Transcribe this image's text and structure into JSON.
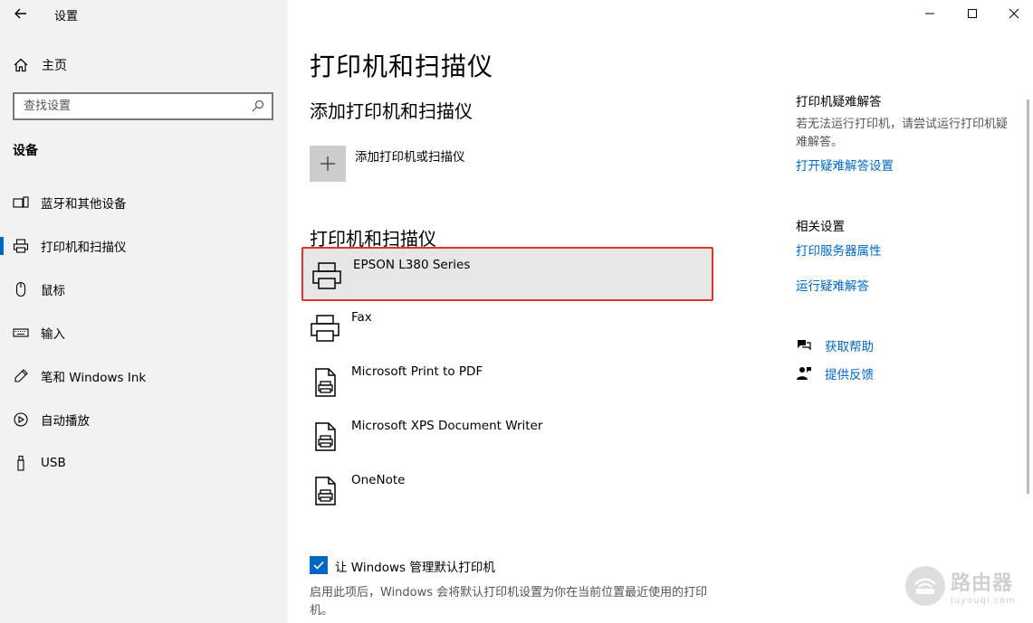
{
  "window": {
    "title": "设置",
    "minimize_icon": "minimize-icon",
    "maximize_icon": "maximize-icon",
    "close_icon": "close-icon"
  },
  "sidebar": {
    "home_label": "主页",
    "search_placeholder": "查找设置",
    "section_label": "设备",
    "items": [
      {
        "label": "蓝牙和其他设备",
        "icon": "bluetooth-devices-icon",
        "active": false
      },
      {
        "label": "打印机和扫描仪",
        "icon": "printer-icon",
        "active": true
      },
      {
        "label": "鼠标",
        "icon": "mouse-icon",
        "active": false
      },
      {
        "label": "输入",
        "icon": "keyboard-icon",
        "active": false
      },
      {
        "label": "笔和 Windows Ink",
        "icon": "pen-icon",
        "active": false
      },
      {
        "label": "自动播放",
        "icon": "autoplay-icon",
        "active": false
      },
      {
        "label": "USB",
        "icon": "usb-icon",
        "active": false
      }
    ]
  },
  "main": {
    "page_title": "打印机和扫描仪",
    "add_section_title": "添加打印机和扫描仪",
    "add_button_label": "添加打印机或扫描仪",
    "list_section_title": "打印机和扫描仪",
    "printers": [
      {
        "name": "EPSON L380 Series",
        "icon": "printer-icon",
        "selected": true
      },
      {
        "name": "Fax",
        "icon": "printer-icon",
        "selected": false
      },
      {
        "name": "Microsoft Print to PDF",
        "icon": "document-printer-icon",
        "selected": false
      },
      {
        "name": "Microsoft XPS Document Writer",
        "icon": "document-printer-icon",
        "selected": false
      },
      {
        "name": "OneNote",
        "icon": "document-printer-icon",
        "selected": false
      }
    ],
    "default_printer_checkbox_label": "让 Windows 管理默认打印机",
    "default_printer_checked": true,
    "default_printer_description": "启用此项后，Windows 会将默认打印机设置为你在当前位置最近使用的打印机。"
  },
  "right_panel": {
    "troubleshoot_heading": "打印机疑难解答",
    "troubleshoot_text": "若无法运行打印机，请尝试运行打印机疑难解答。",
    "troubleshoot_link": "打开疑难解答设置",
    "related_heading": "相关设置",
    "print_server_link": "打印服务器属性",
    "run_troubleshooter_link": "运行疑难解答",
    "get_help_label": "获取帮助",
    "feedback_label": "提供反馈"
  },
  "watermark": {
    "main": "路由器",
    "sub": "luyouqi.com"
  },
  "colors": {
    "accent": "#0067c0",
    "sidebar_bg": "#f2f2f2",
    "selection_border": "#e0322e",
    "selection_bg": "#e6e6e6"
  }
}
